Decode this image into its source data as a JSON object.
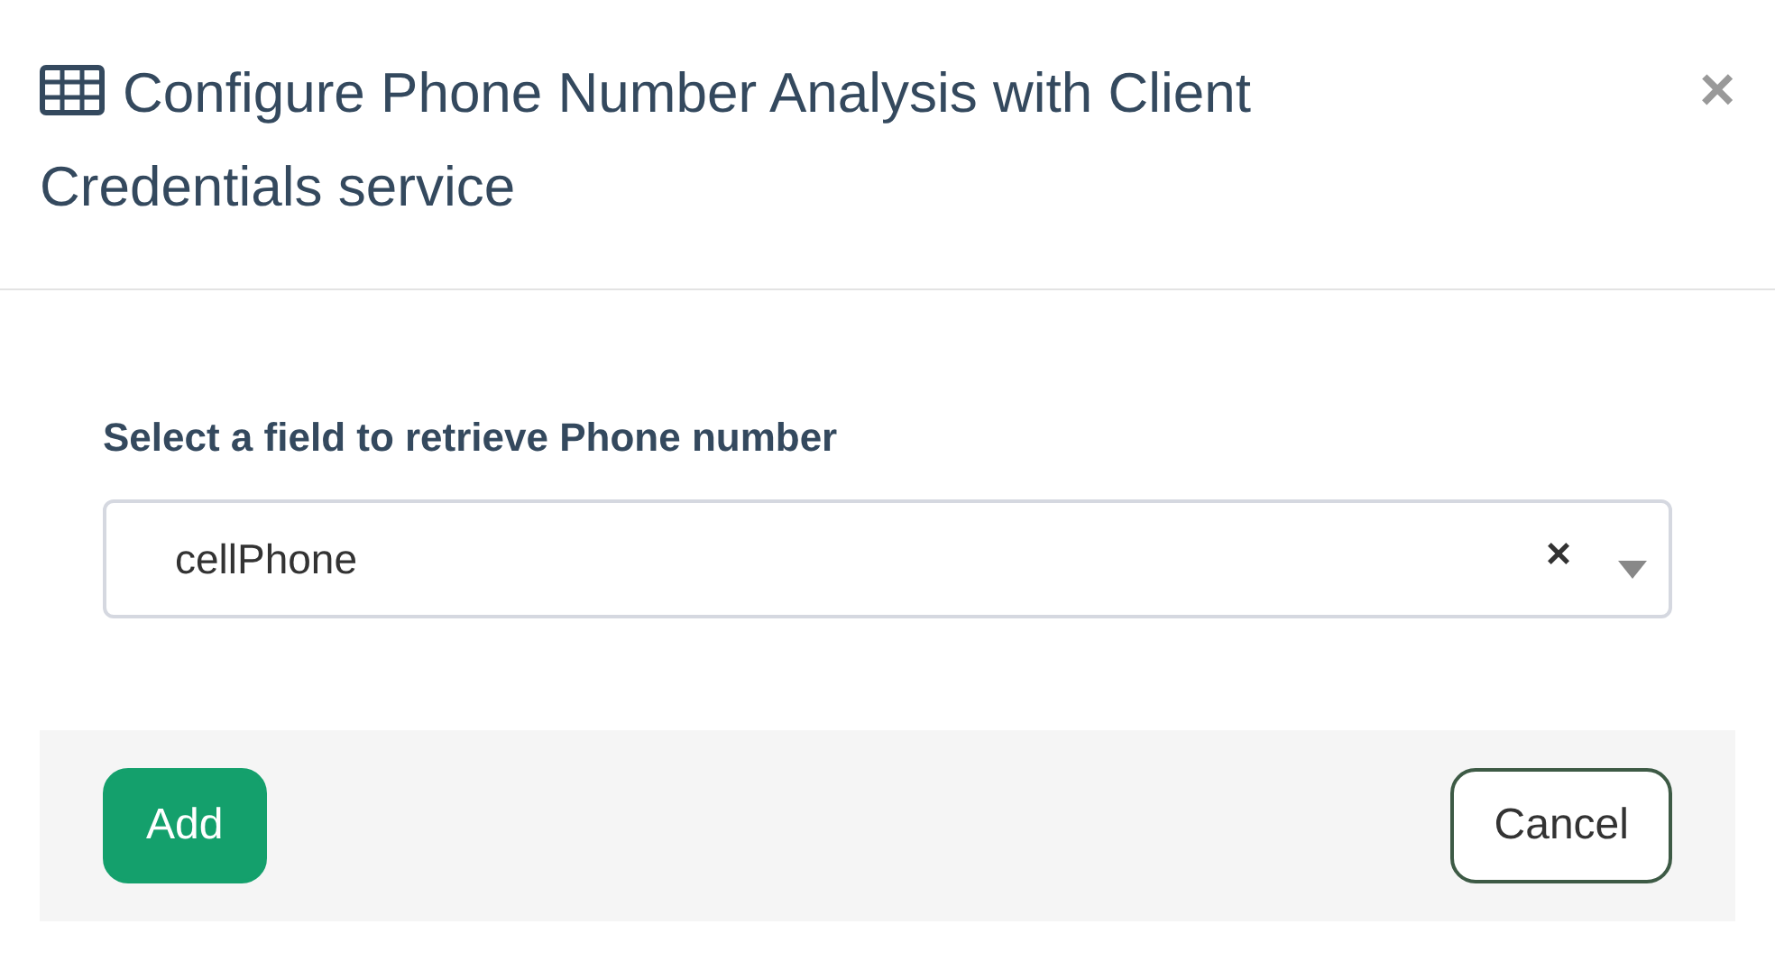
{
  "dialog": {
    "title": "Configure Phone Number Analysis with Client Credentials service",
    "close": "×"
  },
  "field": {
    "label": "Select a field to retrieve Phone number",
    "value": "cellPhone",
    "clear": "×"
  },
  "buttons": [
    {
      "kind": "primary",
      "label": "Add"
    },
    {
      "kind": "secondary",
      "label": "Cancel"
    }
  ]
}
